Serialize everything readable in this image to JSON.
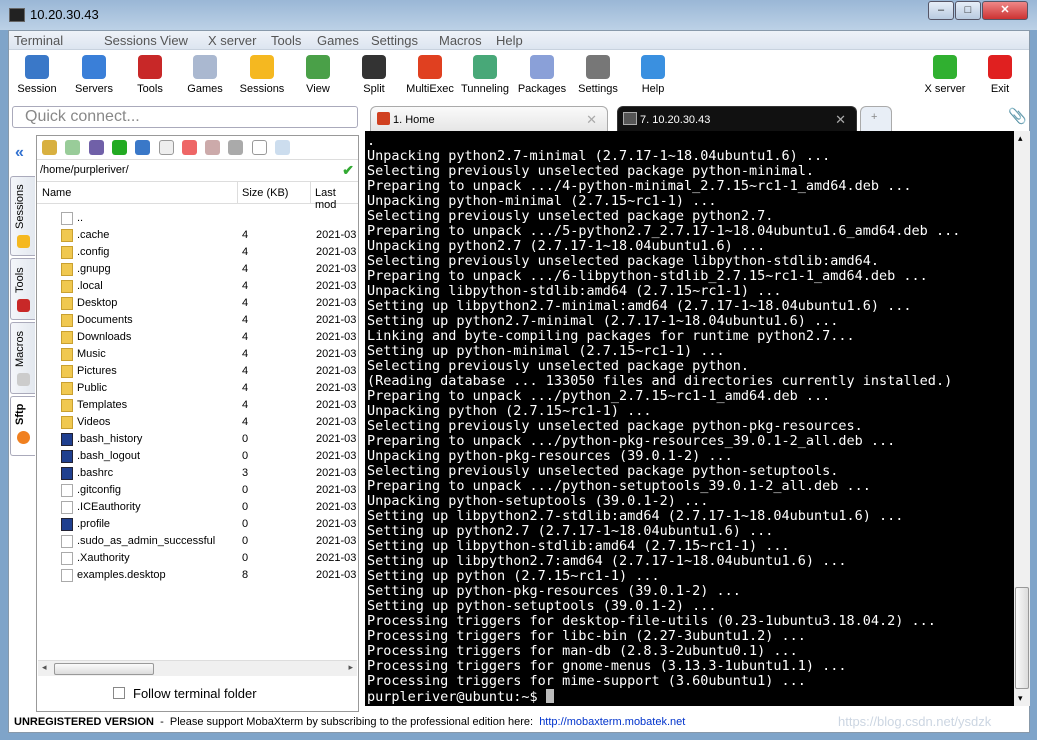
{
  "window": {
    "title": "10.20.30.43",
    "controls": [
      "–",
      "□",
      "✕"
    ]
  },
  "menu": [
    "Terminal",
    "Sessions",
    "View",
    "X server",
    "Tools",
    "Games",
    "Settings",
    "Macros",
    "Help"
  ],
  "toolbar": [
    {
      "label": "Session",
      "icon": "session-icon",
      "color": "#3a78c8"
    },
    {
      "label": "Servers",
      "icon": "servers-icon",
      "color": "#3a7fd8"
    },
    {
      "label": "Tools",
      "icon": "tools-icon",
      "color": "#c82828"
    },
    {
      "label": "Games",
      "icon": "games-icon",
      "color": "#aab8d0"
    },
    {
      "label": "Sessions",
      "icon": "star-icon",
      "color": "#f5b820"
    },
    {
      "label": "View",
      "icon": "view-icon",
      "color": "#4aa048"
    },
    {
      "label": "Split",
      "icon": "split-icon",
      "color": "#333333"
    },
    {
      "label": "MultiExec",
      "icon": "multiexec-icon",
      "color": "#e04020"
    },
    {
      "label": "Tunneling",
      "icon": "tunneling-icon",
      "color": "#48a878"
    },
    {
      "label": "Packages",
      "icon": "packages-icon",
      "color": "#8aa0d8"
    },
    {
      "label": "Settings",
      "icon": "settings-icon",
      "color": "#777777"
    },
    {
      "label": "Help",
      "icon": "help-icon",
      "color": "#3a90e0"
    },
    {
      "label": "X server",
      "icon": "x-server-icon",
      "color": "#30b030"
    },
    {
      "label": "Exit",
      "icon": "exit-icon",
      "color": "#e02020"
    }
  ],
  "quick_connect": {
    "placeholder": "Quick connect..."
  },
  "side_tabs": [
    "Sessions",
    "Tools",
    "Macros",
    "Sftp"
  ],
  "sftp": {
    "path": "/home/purpleriver/",
    "columns": [
      "Name",
      "Size (KB)",
      "Last mod"
    ],
    "files": [
      {
        "name": "..",
        "size": "",
        "mod": "",
        "type": "up"
      },
      {
        "name": ".cache",
        "size": "4",
        "mod": "2021-03",
        "type": "folder"
      },
      {
        "name": ".config",
        "size": "4",
        "mod": "2021-03",
        "type": "folder"
      },
      {
        "name": ".gnupg",
        "size": "4",
        "mod": "2021-03",
        "type": "folder"
      },
      {
        "name": ".local",
        "size": "4",
        "mod": "2021-03",
        "type": "folder"
      },
      {
        "name": "Desktop",
        "size": "4",
        "mod": "2021-03",
        "type": "folder"
      },
      {
        "name": "Documents",
        "size": "4",
        "mod": "2021-03",
        "type": "folder"
      },
      {
        "name": "Downloads",
        "size": "4",
        "mod": "2021-03",
        "type": "folder"
      },
      {
        "name": "Music",
        "size": "4",
        "mod": "2021-03",
        "type": "folder"
      },
      {
        "name": "Pictures",
        "size": "4",
        "mod": "2021-03",
        "type": "folder"
      },
      {
        "name": "Public",
        "size": "4",
        "mod": "2021-03",
        "type": "folder"
      },
      {
        "name": "Templates",
        "size": "4",
        "mod": "2021-03",
        "type": "folder"
      },
      {
        "name": "Videos",
        "size": "4",
        "mod": "2021-03",
        "type": "folder"
      },
      {
        "name": ".bash_history",
        "size": "0",
        "mod": "2021-03",
        "type": "sfile"
      },
      {
        "name": ".bash_logout",
        "size": "0",
        "mod": "2021-03",
        "type": "sfile"
      },
      {
        "name": ".bashrc",
        "size": "3",
        "mod": "2021-03",
        "type": "sfile"
      },
      {
        "name": ".gitconfig",
        "size": "0",
        "mod": "2021-03",
        "type": "file"
      },
      {
        "name": ".ICEauthority",
        "size": "0",
        "mod": "2021-03",
        "type": "file"
      },
      {
        "name": ".profile",
        "size": "0",
        "mod": "2021-03",
        "type": "sfile"
      },
      {
        "name": ".sudo_as_admin_successful",
        "size": "0",
        "mod": "2021-03",
        "type": "file"
      },
      {
        "name": ".Xauthority",
        "size": "0",
        "mod": "2021-03",
        "type": "file"
      },
      {
        "name": "examples.desktop",
        "size": "8",
        "mod": "2021-03",
        "type": "file"
      }
    ],
    "follow_label": "Follow terminal folder"
  },
  "tabs": [
    {
      "label": "1. Home",
      "active": false
    },
    {
      "label": "7. 10.20.30.43",
      "active": true
    }
  ],
  "terminal": {
    "lines": [
      ".",
      "Unpacking python2.7-minimal (2.7.17-1~18.04ubuntu1.6) ...",
      "Selecting previously unselected package python-minimal.",
      "Preparing to unpack .../4-python-minimal_2.7.15~rc1-1_amd64.deb ...",
      "Unpacking python-minimal (2.7.15~rc1-1) ...",
      "Selecting previously unselected package python2.7.",
      "Preparing to unpack .../5-python2.7_2.7.17-1~18.04ubuntu1.6_amd64.deb ...",
      "Unpacking python2.7 (2.7.17-1~18.04ubuntu1.6) ...",
      "Selecting previously unselected package libpython-stdlib:amd64.",
      "Preparing to unpack .../6-libpython-stdlib_2.7.15~rc1-1_amd64.deb ...",
      "Unpacking libpython-stdlib:amd64 (2.7.15~rc1-1) ...",
      "Setting up libpython2.7-minimal:amd64 (2.7.17-1~18.04ubuntu1.6) ...",
      "Setting up python2.7-minimal (2.7.17-1~18.04ubuntu1.6) ...",
      "Linking and byte-compiling packages for runtime python2.7...",
      "Setting up python-minimal (2.7.15~rc1-1) ...",
      "Selecting previously unselected package python.",
      "(Reading database ... 133050 files and directories currently installed.)",
      "Preparing to unpack .../python_2.7.15~rc1-1_amd64.deb ...",
      "Unpacking python (2.7.15~rc1-1) ...",
      "Selecting previously unselected package python-pkg-resources.",
      "Preparing to unpack .../python-pkg-resources_39.0.1-2_all.deb ...",
      "Unpacking python-pkg-resources (39.0.1-2) ...",
      "Selecting previously unselected package python-setuptools.",
      "Preparing to unpack .../python-setuptools_39.0.1-2_all.deb ...",
      "Unpacking python-setuptools (39.0.1-2) ...",
      "Setting up libpython2.7-stdlib:amd64 (2.7.17-1~18.04ubuntu1.6) ...",
      "Setting up python2.7 (2.7.17-1~18.04ubuntu1.6) ...",
      "Setting up libpython-stdlib:amd64 (2.7.15~rc1-1) ...",
      "Setting up libpython2.7:amd64 (2.7.17-1~18.04ubuntu1.6) ...",
      "Setting up python (2.7.15~rc1-1) ...",
      "Setting up python-pkg-resources (39.0.1-2) ...",
      "Setting up python-setuptools (39.0.1-2) ...",
      "Processing triggers for desktop-file-utils (0.23-1ubuntu3.18.04.2) ...",
      "Processing triggers for libc-bin (2.27-3ubuntu1.2) ...",
      "Processing triggers for man-db (2.8.3-2ubuntu0.1) ...",
      "Processing triggers for gnome-menus (3.13.3-1ubuntu1.1) ...",
      "Processing triggers for mime-support (3.60ubuntu1) ..."
    ],
    "prompt": "purpleriver@ubuntu:~$ "
  },
  "status": {
    "bold": "UNREGISTERED VERSION",
    "text": "  -  Please support MobaXterm by subscribing to the professional edition here:  ",
    "link": "http://mobaxterm.mobatek.net"
  },
  "watermark": "https://blog.csdn.net/ysdzk"
}
